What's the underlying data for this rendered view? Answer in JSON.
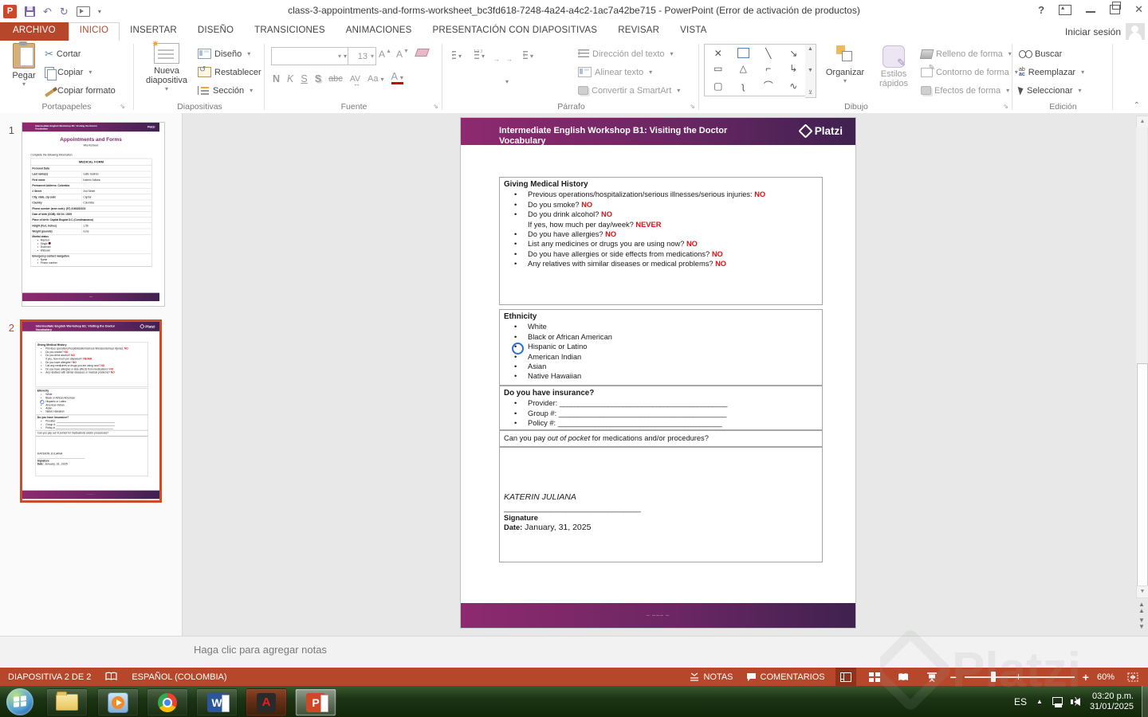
{
  "titlebar": {
    "title": "class-3-appointments-and-forms-worksheet_bc3fd618-7248-4a24-a4c2-1ac7a42be715 - PowerPoint (Error de activación de productos)",
    "signin": "Iniciar sesión"
  },
  "icons": {
    "help": "?",
    "close": "✕",
    "undo": "↶",
    "redo": "↻",
    "cut": "✂",
    "collapse": "⌃",
    "launcher": "⇘",
    "shapes": [
      "✕",
      "",
      "╲",
      "↘",
      "▭",
      "△",
      "⌐",
      "↳",
      "▢",
      "ʅ",
      "⌒",
      "∿"
    ]
  },
  "tabs": {
    "archivo": "ARCHIVO",
    "inicio": "INICIO",
    "insertar": "INSERTAR",
    "diseno": "DISEÑO",
    "transiciones": "TRANSICIONES",
    "animaciones": "ANIMACIONES",
    "presentacion": "PRESENTACIÓN CON DIAPOSITIVAS",
    "revisar": "REVISAR",
    "vista": "VISTA"
  },
  "ribbon": {
    "paste": "Pegar",
    "cut": "Cortar",
    "copy": "Copiar",
    "format_painter": "Copiar formato",
    "group_clipboard": "Portapapeles",
    "new_slide": "Nueva diapositiva",
    "layout": "Diseño",
    "reset": "Restablecer",
    "section": "Sección",
    "group_slides": "Diapositivas",
    "font_size": "13",
    "bold": "N",
    "italic": "K",
    "underline": "S",
    "shadow": "S",
    "strikethrough": "abc",
    "char_spacing": "AV",
    "change_case": "Aa",
    "font_color": "A",
    "grow_font": "A",
    "shrink_font": "A",
    "group_font": "Fuente",
    "text_direction": "Dirección del texto",
    "align_text": "Alinear texto",
    "smartart": "Convertir a SmartArt",
    "group_paragraph": "Párrafo",
    "arrange": "Organizar",
    "quick_styles": "Estilos rápidos",
    "shape_fill": "Relleno de forma",
    "shape_outline": "Contorno de forma",
    "shape_effects": "Efectos de forma",
    "group_drawing": "Dibujo",
    "find": "Buscar",
    "replace": "Reemplazar",
    "select": "Seleccionar",
    "group_editing": "Edición",
    "replace_ab": "ab",
    "replace_ac": "ac"
  },
  "slide": {
    "header": {
      "title": "Intermediate English Workshop B1: Visiting the Doctor Vocabulary",
      "brand": "Platzi"
    },
    "medical_history": {
      "heading": "Giving Medical History",
      "items": [
        {
          "q": "Previous operations/hospitalization/serious illnesses/serious injuries: ",
          "a": "NO"
        },
        {
          "q": "Do you smoke? ",
          "a": "NO"
        },
        {
          "q": "Do you drink alcohol? ",
          "a": "NO"
        },
        {
          "q": "If yes, how much per day/week? ",
          "a": "NEVER"
        },
        {
          "q": "Do you have allergies? ",
          "a": "NO"
        },
        {
          "q": "List any medicines or drugs you are using now? ",
          "a": "NO"
        },
        {
          "q": "Do you have allergies or side effects from medications? ",
          "a": "NO"
        },
        {
          "q": "Any relatives with similar diseases or medical problems? ",
          "a": "NO"
        }
      ]
    },
    "ethnicity": {
      "heading": "Ethnicity",
      "options": [
        "White",
        "Black or African American",
        "Hispanic or Latino",
        "American Indian",
        "Asian",
        "Native Hawaiian"
      ],
      "selected": "Hispanic or Latino"
    },
    "insurance": {
      "heading": "Do you have insurance?",
      "fields": [
        {
          "label": "Provider: ",
          "line": "_____________________________________________"
        },
        {
          "label": "Group #: ",
          "line": "_____________________________________________"
        },
        {
          "label": "Policy #: ",
          "line": "____________________________________________"
        }
      ]
    },
    "out_of_pocket": {
      "pre": "Can you pay ",
      "em": "out of pocket",
      "post": " for medications and/or procedures?"
    },
    "signature": {
      "name": "KATERIN JULIANA",
      "line": "______________________________________",
      "label": "Signature",
      "date_label": "Date:",
      "date_value": " January, 31, 2025"
    },
    "footer_note": "— ——— —"
  },
  "thumbnails": {
    "one": {
      "number": "1",
      "title": "Appointments and Forms",
      "subtitle": "Worksheet",
      "intro": "Complete the following information",
      "form_title": "MEDICAL FORM",
      "rows": [
        {
          "l": "Personal Data",
          "v": ""
        },
        {
          "l": "Last name(s)",
          "v": "Gallo Galindo"
        },
        {
          "l": "First name",
          "v": "Katerin Juliana"
        },
        {
          "l": "Permanent Address: Colombia",
          "v": ""
        },
        {
          "l": "# Street",
          "v": "2nd Street"
        },
        {
          "l": "City, state, zip code",
          "v": "Capital"
        },
        {
          "l": "Country",
          "v": "Colombia"
        },
        {
          "l": "Phone number (area code): (57) 3163452223",
          "v": ""
        },
        {
          "l": "Date of birth (DOB): 08/ 04 / 2005",
          "v": ""
        },
        {
          "l": "Place of birth: Capital Bogotá D.C (Cundinamarca)",
          "v": ""
        },
        {
          "l": "Height (feet, inches)",
          "v": "1.56"
        },
        {
          "l": "Weight (pounds)",
          "v": "none"
        }
      ],
      "marital": {
        "label": "Marital status",
        "options": [
          "Married",
          "Single",
          "Divorced",
          "Widower"
        ]
      },
      "emergency": {
        "label": "Emergency contact navigation",
        "options": [
          "Name",
          "Phone number"
        ]
      }
    },
    "two": {
      "number": "2"
    }
  },
  "notes": {
    "placeholder": "Haga clic para agregar notas"
  },
  "statusbar": {
    "slide_indicator": "DIAPOSITIVA 2 DE 2",
    "language": "ESPAÑOL (COLOMBIA)",
    "notes": "NOTAS",
    "comments": "COMENTARIOS",
    "zoom_level": "60%"
  },
  "taskbar": {
    "tray": {
      "lang": "ES",
      "time": "03:20 p.m.",
      "date": "31/01/2025"
    }
  },
  "colors": {
    "accent_red": "#b7472a",
    "brand_purple_left": "#8e2a6f",
    "brand_purple_right": "#3f2150",
    "answer_red": "#e01112",
    "selection_orange": "#cd4b26"
  }
}
